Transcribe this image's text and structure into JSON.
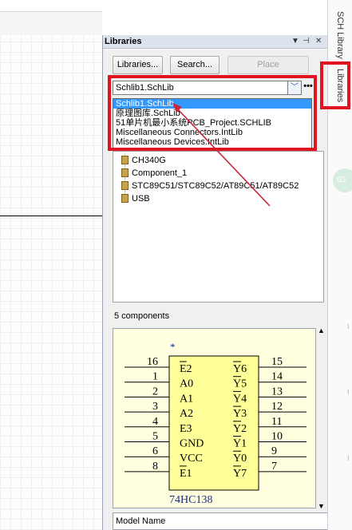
{
  "right_tabs": {
    "sch_library": "SCH Library",
    "libraries": "Libraries",
    "bubble": "65"
  },
  "panel": {
    "title": "Libraries",
    "controls": {
      "menu": "▼",
      "pin": "⊣",
      "close": "✕"
    },
    "buttons": {
      "libraries": "Libraries...",
      "search": "Search...",
      "place": "Place"
    },
    "selected_library": "Schlib1.SchLib",
    "more": "•••",
    "dropdown_options": [
      "Schlib1.SchLib",
      "原理图库.SchLib",
      "51单片机最小系统PCB_Project.SCHLIB",
      "Miscellaneous Connectors.IntLib",
      "Miscellaneous Devices.IntLib"
    ],
    "components": [
      "CH340G",
      "Component_1",
      "STC89C51/STC89C52/AT89C51/AT89C52",
      "USB"
    ],
    "component_count": "5 components",
    "model_header": "Model Name"
  },
  "symbol": {
    "part_name": "74HC138",
    "pin1_marker": "*",
    "left_pins": [
      {
        "num": "16",
        "name": "E2",
        "overbar": true
      },
      {
        "num": "1",
        "name": "A0",
        "overbar": false
      },
      {
        "num": "2",
        "name": "A1",
        "overbar": false
      },
      {
        "num": "3",
        "name": "A2",
        "overbar": false
      },
      {
        "num": "4",
        "name": "E3",
        "overbar": false
      },
      {
        "num": "5",
        "name": "GND",
        "overbar": false
      },
      {
        "num": "6",
        "name": "VCC",
        "overbar": false
      },
      {
        "num": "8",
        "name": "E1",
        "overbar": true
      }
    ],
    "right_pins": [
      {
        "num": "15",
        "name": "Y6",
        "overbar": true
      },
      {
        "num": "14",
        "name": "Y5",
        "overbar": true
      },
      {
        "num": "13",
        "name": "Y4",
        "overbar": true
      },
      {
        "num": "12",
        "name": "Y3",
        "overbar": true
      },
      {
        "num": "11",
        "name": "Y2",
        "overbar": true
      },
      {
        "num": "10",
        "name": "Y1",
        "overbar": true
      },
      {
        "num": "9",
        "name": "Y0",
        "overbar": true
      },
      {
        "num": "7",
        "name": "Y7",
        "overbar": true
      }
    ]
  },
  "colors": {
    "highlight": "#e0141e",
    "selection": "#3399ff",
    "preview_bg": "#ffffe0",
    "body_fill": "#ffff99"
  }
}
